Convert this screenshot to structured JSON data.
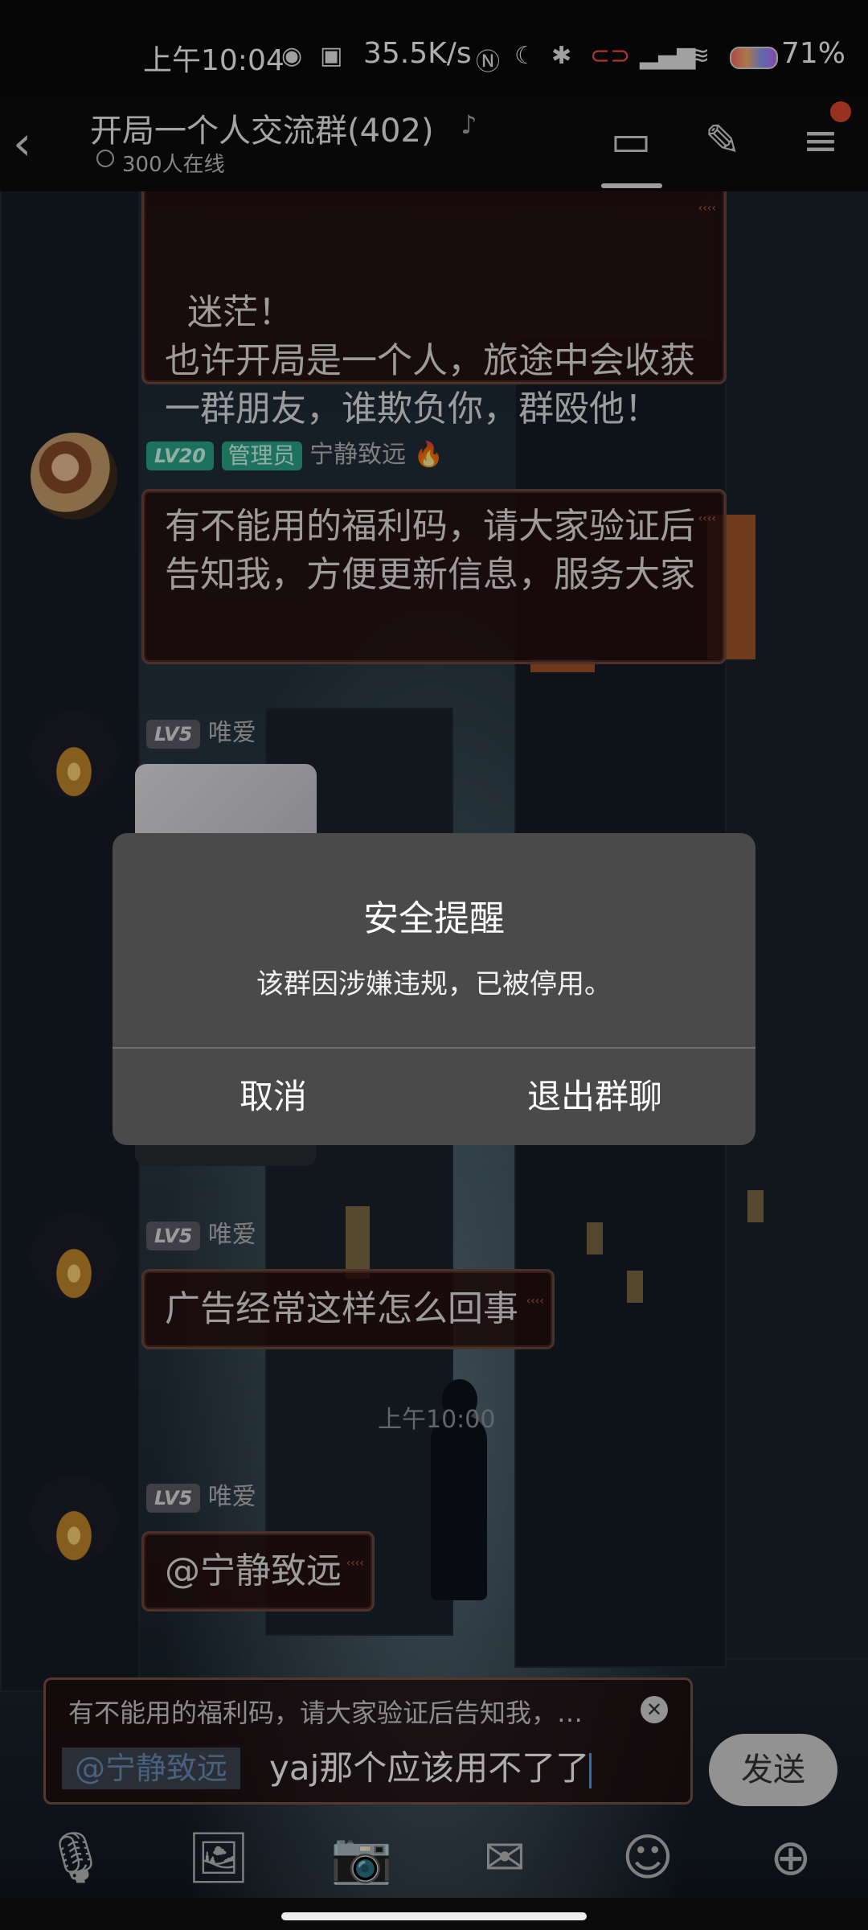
{
  "status_bar": {
    "time": "上午10:04",
    "net_speed": "35.5K/s",
    "battery": "71%"
  },
  "header": {
    "title": "开局一个人交流群(402)",
    "online": "300人在线"
  },
  "messages": {
    "m0": {
      "text": "迷茫！\n也许开局是一个人，旅途中会收获一群朋友，谁欺负你，群殴他！"
    },
    "m1": {
      "level": "LV20",
      "role": "管理员",
      "name": "宁静致远",
      "text": "有不能用的福利码，请大家验证后告知我，方便更新信息，服务大家"
    },
    "m2": {
      "level": "LV5",
      "name": "唯爱"
    },
    "m3": {
      "level": "LV5",
      "name": "唯爱",
      "text": "广告经常这样怎么回事"
    },
    "timestamp": "上午10:00",
    "m4": {
      "level": "LV5",
      "name": "唯爱",
      "text": "@宁静致远"
    }
  },
  "dialog": {
    "title": "安全提醒",
    "message": "该群因涉嫌违规，已被停用。",
    "cancel": "取消",
    "exit": "退出群聊"
  },
  "input": {
    "quote": "有不能用的福利码，请大家验证后告知我，…",
    "mention": "@宁静致远",
    "text": "yaj那个应该用不了了",
    "send": "发送"
  },
  "icons": {
    "back": "chevron-left-icon",
    "ear": "ear-icon",
    "chat": "chat-bubble-icon",
    "edit": "edit-icon",
    "menu": "menu-icon",
    "fire": "fire-icon",
    "mic": "microphone-icon",
    "image": "image-icon",
    "camera": "camera-icon",
    "bag": "red-packet-icon",
    "emoji": "emoji-icon",
    "plus": "plus-icon"
  }
}
